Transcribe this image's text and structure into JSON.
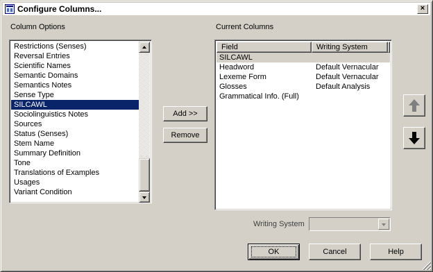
{
  "window": {
    "title": "Configure Columns...",
    "close_label": "×"
  },
  "column_options": {
    "label": "Column Options",
    "items": [
      "Restrictions (Senses)",
      "Reversal Entries",
      "Scientific Names",
      "Semantic Domains",
      "Semantics Notes",
      "Sense Type",
      "SILCAWL",
      "Sociolinguistics Notes",
      "Sources",
      "Status (Senses)",
      "Stem Name",
      "Summary Definition",
      "Tone",
      "Translations of Examples",
      "Usages",
      "Variant Condition"
    ],
    "selected": "SILCAWL"
  },
  "actions": {
    "add_label": "Add >>",
    "remove_label": "Remove"
  },
  "current_columns": {
    "label": "Current Columns",
    "headers": [
      "Field",
      "Writing System"
    ],
    "rows": [
      {
        "field": "SILCAWL",
        "ws": ""
      },
      {
        "field": "Headword",
        "ws": "Default Vernacular"
      },
      {
        "field": "Lexeme Form",
        "ws": "Default Vernacular"
      },
      {
        "field": "Glosses",
        "ws": "Default Analysis"
      },
      {
        "field": "Grammatical Info. (Full)",
        "ws": ""
      }
    ],
    "selected_row": 0
  },
  "move": {
    "up_icon": "arrow-up-icon",
    "down_icon": "arrow-down-icon"
  },
  "writing_system": {
    "label": "Writing System",
    "value": ""
  },
  "footer": {
    "ok_label": "OK",
    "cancel_label": "Cancel",
    "help_label": "Help"
  }
}
